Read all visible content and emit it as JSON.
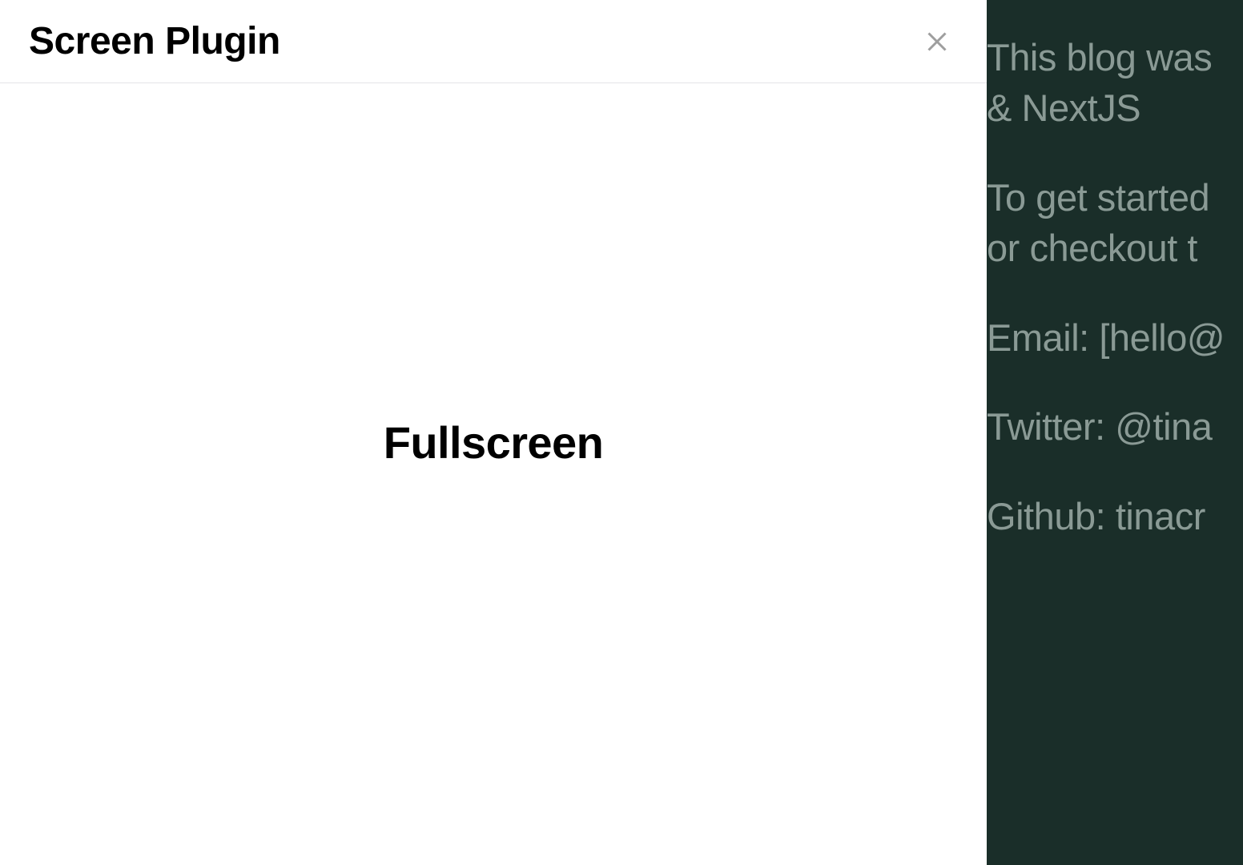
{
  "modal": {
    "title": "Screen Plugin",
    "content_heading": "Fullscreen"
  },
  "background": {
    "paragraphs": [
      "This blog was",
      "& NextJS"
    ],
    "lines": [
      "To get started",
      "or checkout t"
    ],
    "contacts": [
      "Email: [hello@",
      "Twitter: @tina",
      "Github: tinacr"
    ]
  }
}
